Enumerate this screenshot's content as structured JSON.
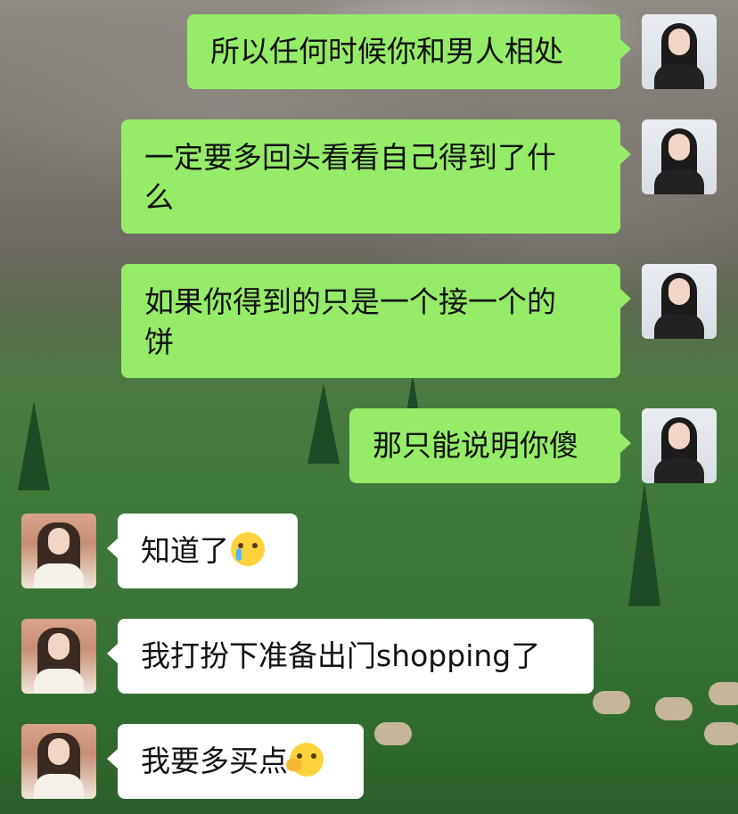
{
  "background": {
    "theme": "alpine-meadow-scene",
    "accent": "#95ec69"
  },
  "messages": [
    {
      "side": "right",
      "lines": [
        "所以任何时候你和男人相处"
      ]
    },
    {
      "side": "right",
      "lines": [
        "一定要多回头看看自己得到了什",
        "么"
      ]
    },
    {
      "side": "right",
      "lines": [
        "如果你得到的只是一个接一个的",
        "饼"
      ]
    },
    {
      "side": "right",
      "lines": [
        "那只能说明你傻"
      ]
    },
    {
      "side": "left",
      "lines": [
        "知道了"
      ],
      "emoji": "crying-face-emoji"
    },
    {
      "side": "left",
      "lines": [
        "我打扮下准备出门shopping了"
      ]
    },
    {
      "side": "left",
      "lines": [
        "我要多买点"
      ],
      "emoji": "face-with-hand-over-mouth-emoji"
    }
  ],
  "colors": {
    "sent_bubble": "#95ec69",
    "received_bubble": "#ffffff",
    "text": "#111111"
  }
}
